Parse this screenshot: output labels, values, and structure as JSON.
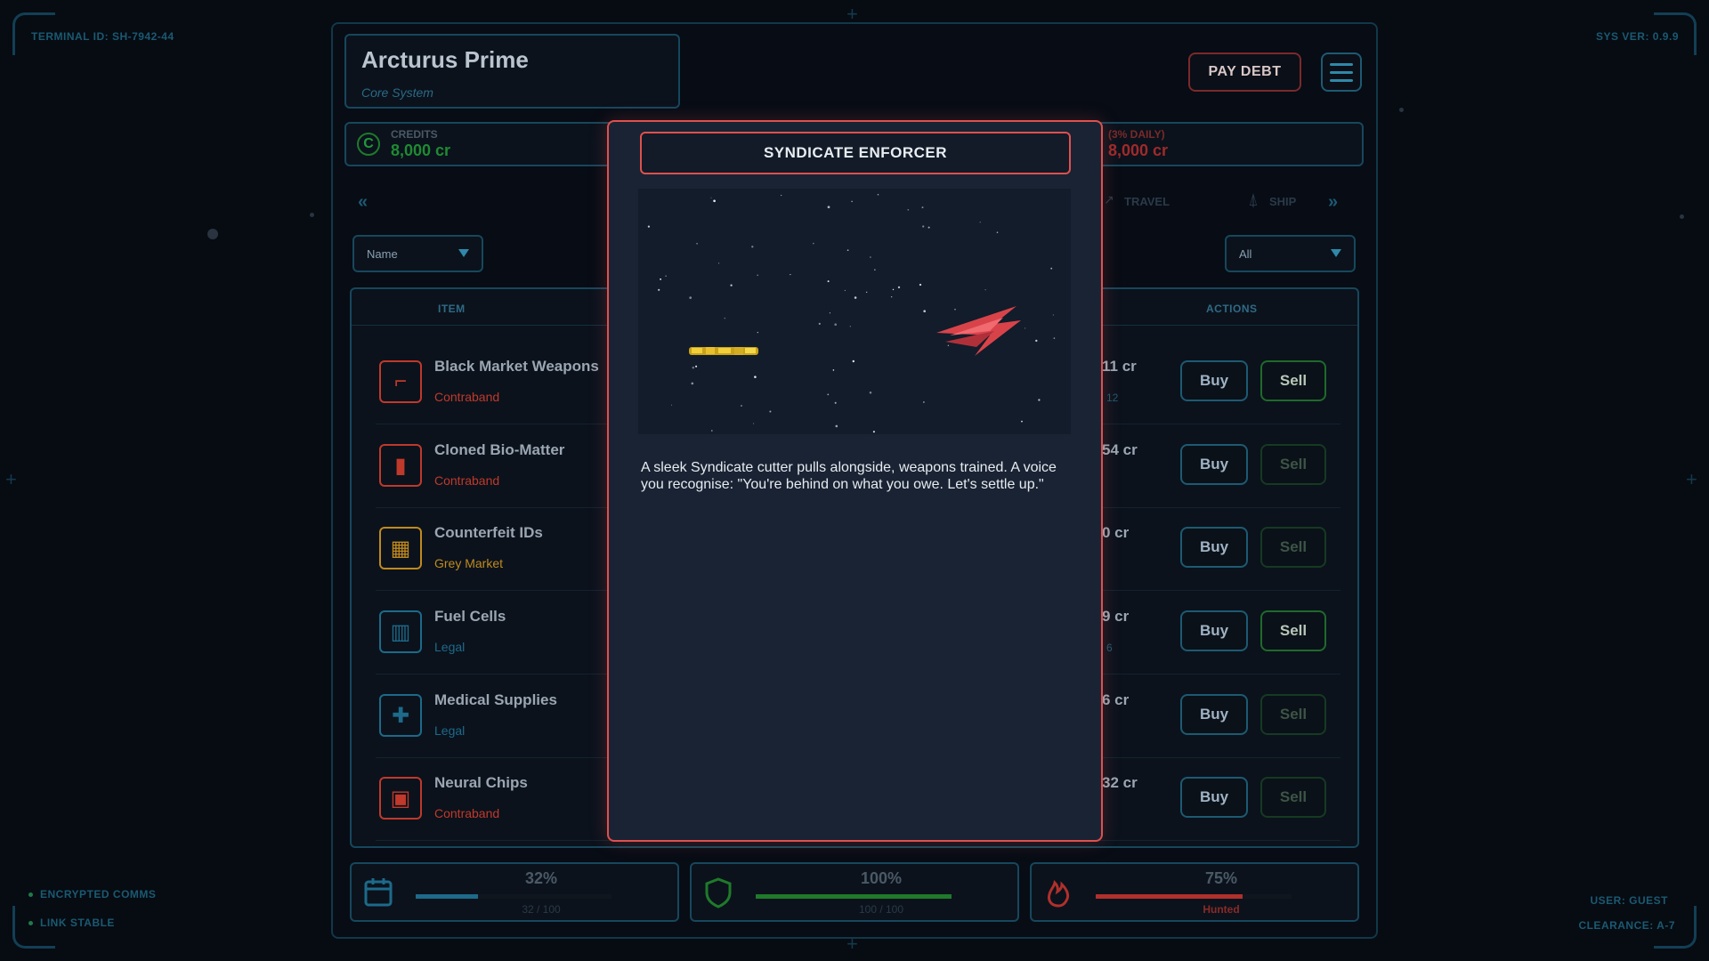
{
  "hud": {
    "terminal_id": "TERMINAL ID: SH-7942-44",
    "sys_ver": "SYS VER: 0.9.9",
    "status": [
      "ENCRYPTED COMMS",
      "LINK STABLE"
    ],
    "user": "USER: GUEST",
    "clearance": "CLEARANCE: A-7"
  },
  "location": {
    "name": "Arcturus Prime",
    "subtitle": "Core System"
  },
  "header": {
    "pay_debt_label": "PAY DEBT",
    "menu_icon": "hamburger-icon"
  },
  "credits": {
    "label": "CREDITS",
    "value": "8,000 cr",
    "icon": "credits-icon"
  },
  "debt": {
    "label": "(3% DAILY)",
    "value": "8,000 cr"
  },
  "nav": {
    "travel_label": "TRAVEL",
    "ship_label": "SHIP"
  },
  "filters": {
    "sort_value": "Name",
    "category_value": "All"
  },
  "table": {
    "headers": {
      "item": "ITEM",
      "actions": "ACTIONS"
    },
    "buy_label": "Buy",
    "sell_label": "Sell",
    "rows": [
      {
        "name": "Black Market Weapons",
        "category": "Contraband",
        "price": "11 cr",
        "qty": "12",
        "sell_enabled": true,
        "icon": "weapon-icon",
        "color": "#c0392b"
      },
      {
        "name": "Cloned Bio-Matter",
        "category": "Contraband",
        "price": "54 cr",
        "qty": "",
        "sell_enabled": false,
        "icon": "vial-icon",
        "color": "#c0392b"
      },
      {
        "name": "Counterfeit IDs",
        "category": "Grey Market",
        "price": "0 cr",
        "qty": "",
        "sell_enabled": false,
        "icon": "id-card-icon",
        "color": "#c08a1e"
      },
      {
        "name": "Fuel Cells",
        "category": "Legal",
        "price": "9 cr",
        "qty": "6",
        "sell_enabled": true,
        "icon": "fuel-cell-icon",
        "color": "#1d6a8a"
      },
      {
        "name": "Medical Supplies",
        "category": "Legal",
        "price": "6 cr",
        "qty": "",
        "sell_enabled": false,
        "icon": "medkit-icon",
        "color": "#1d6a8a"
      },
      {
        "name": "Neural Chips",
        "category": "Contraband",
        "price": "32 cr",
        "qty": "",
        "sell_enabled": false,
        "icon": "chip-icon",
        "color": "#c0392b"
      }
    ]
  },
  "stats": {
    "cargo": {
      "pct": "32%",
      "sub": "32 / 100",
      "fill": 0.32,
      "color": "#1d6a8a",
      "icon": "cargo-icon"
    },
    "hull": {
      "pct": "100%",
      "sub": "100 / 100",
      "fill": 1.0,
      "color": "#1f7a2a",
      "icon": "shield-icon"
    },
    "heat": {
      "pct": "75%",
      "sub": "Hunted",
      "fill": 0.75,
      "color": "#b0302c",
      "icon": "flame-icon"
    }
  },
  "modal": {
    "title": "SYNDICATE ENFORCER",
    "text": "A sleek Syndicate cutter pulls alongside, weapons trained. A voice you recognise: \"You're behind on what you owe. Let's settle up.\""
  }
}
